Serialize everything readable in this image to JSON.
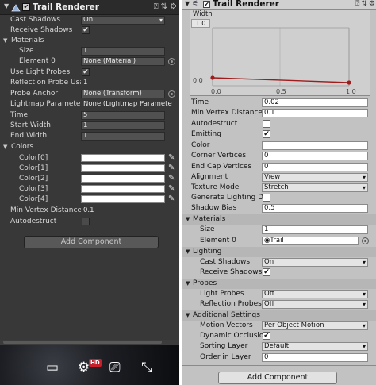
{
  "left": {
    "title": "Trail Renderer",
    "cast_shadows_label": "Cast Shadows",
    "cast_shadows_value": "On",
    "receive_shadows_label": "Receive Shadows",
    "receive_shadows_checked": "✔",
    "materials_label": "Materials",
    "size_label": "Size",
    "size_value": "1",
    "element0_label": "Element 0",
    "element0_value": "None (Material)",
    "use_light_probes_label": "Use Light Probes",
    "use_light_probes_checked": "✔",
    "reflection_probe_label": "Reflection Probe Usa",
    "reflection_probe_value": "1",
    "probe_anchor_label": "Probe Anchor",
    "probe_anchor_value": "None (Transform)",
    "lightmap_params_label": "Lightmap Parameters",
    "lightmap_params_value": "None (Lightmap Paramete",
    "time_label": "Time",
    "time_value": "5",
    "start_width_label": "Start Width",
    "start_width_value": "1",
    "end_width_label": "End Width",
    "end_width_value": "1",
    "colors_label": "Colors",
    "colors": [
      "Color[0]",
      "Color[1]",
      "Color[2]",
      "Color[3]",
      "Color[4]"
    ],
    "min_vertex_label": "Min Vertex Distance",
    "min_vertex_value": "0.1",
    "autodestruct_label": "Autodestruct",
    "add_component": "Add Component"
  },
  "right": {
    "title": "Trail Renderer",
    "curve": {
      "label": "Width",
      "y_top": "1.0",
      "y_bottom": "0.0",
      "x_start": "0.0",
      "x_mid": "0.5",
      "x_end": "1.0",
      "color": "#a01c1c"
    },
    "time_label": "Time",
    "time_value": "0.02",
    "min_vertex_label": "Min Vertex Distance",
    "min_vertex_value": "0.1",
    "autodestruct_label": "Autodestruct",
    "emitting_label": "Emitting",
    "emitting_checked": "✔",
    "color_label": "Color",
    "corner_vertices_label": "Corner Vertices",
    "corner_vertices_value": "0",
    "end_cap_label": "End Cap Vertices",
    "end_cap_value": "0",
    "alignment_label": "Alignment",
    "alignment_value": "View",
    "texture_mode_label": "Texture Mode",
    "texture_mode_value": "Stretch",
    "gen_lighting_label": "Generate Lighting Da",
    "shadow_bias_label": "Shadow Bias",
    "shadow_bias_value": "0.5",
    "materials_label": "Materials",
    "size_label": "Size",
    "size_value": "1",
    "element0_label": "Element 0",
    "element0_value": "Trail",
    "lighting_label": "Lighting",
    "cast_shadows_label": "Cast Shadows",
    "cast_shadows_value": "On",
    "receive_shadows_label": "Receive Shadows",
    "receive_shadows_checked": "✔",
    "probes_label": "Probes",
    "light_probes_label": "Light Probes",
    "light_probes_value": "Off",
    "reflection_probes_label": "Reflection Probes",
    "reflection_probes_value": "Off",
    "additional_label": "Additional Settings",
    "motion_vectors_label": "Motion Vectors",
    "motion_vectors_value": "Per Object Motion",
    "dynamic_occlusion_label": "Dynamic Occlusion",
    "dynamic_occlusion_checked": "✔",
    "sorting_layer_label": "Sorting Layer",
    "sorting_layer_value": "Default",
    "order_in_layer_label": "Order in Layer",
    "order_in_layer_value": "0",
    "add_component": "Add Component"
  },
  "strip": {
    "hd_badge": "HD"
  }
}
